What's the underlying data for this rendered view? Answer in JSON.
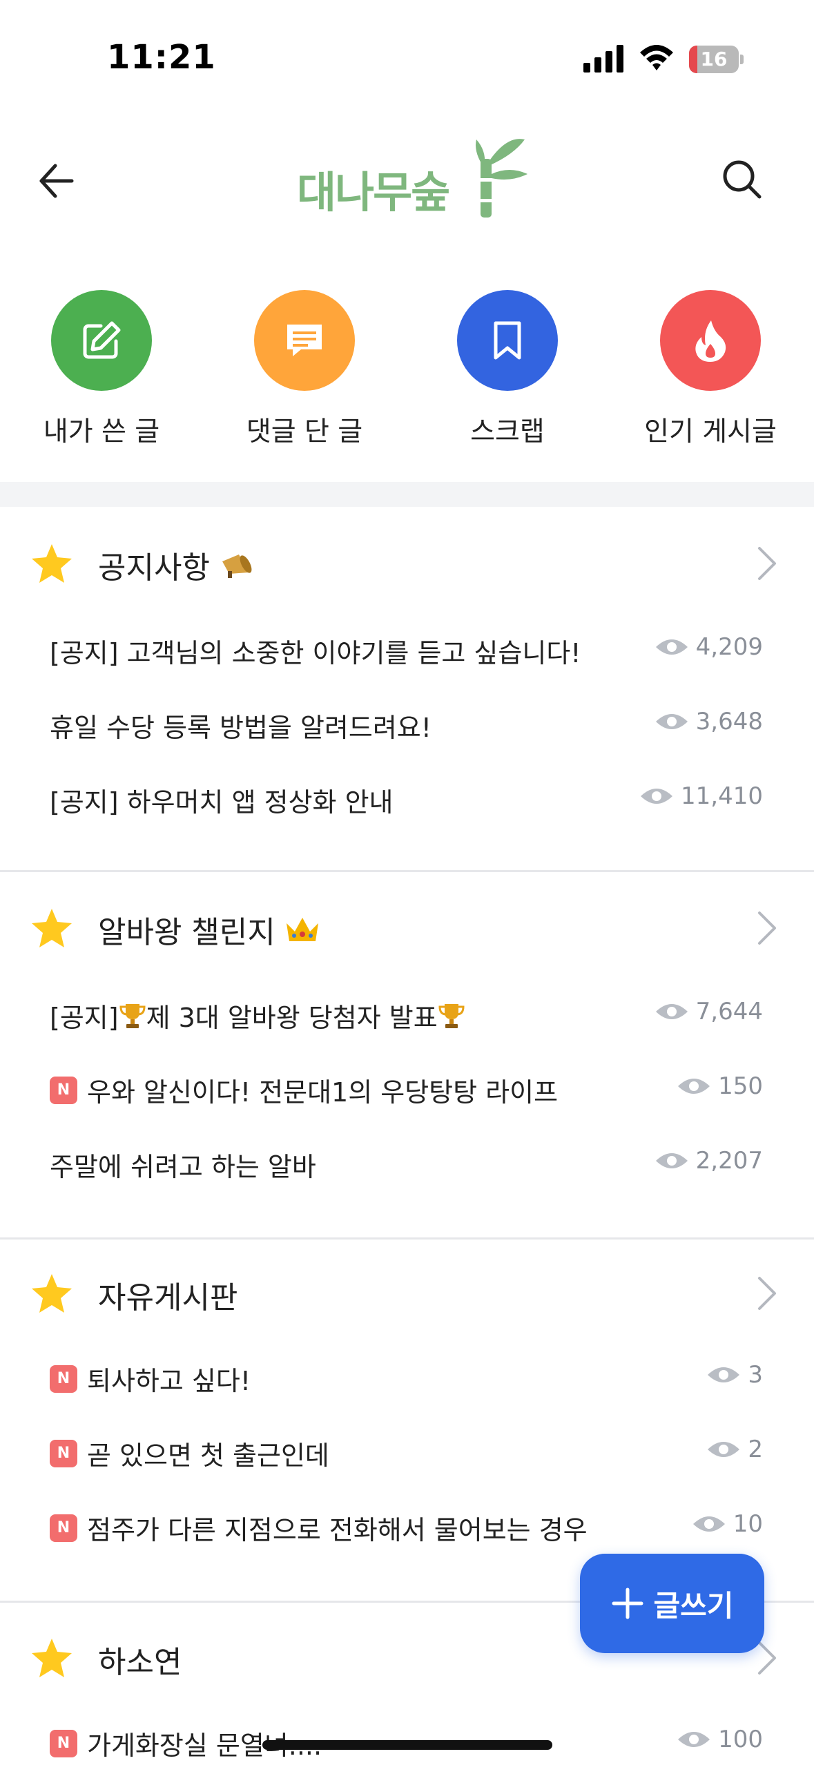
{
  "status": {
    "time": "11:21",
    "battery": "16",
    "battery_level": 0.16
  },
  "header": {
    "logo_text": "대나무숲",
    "back_icon": "back-arrow-icon",
    "search_icon": "search-icon"
  },
  "quick_actions": [
    {
      "label": "내가 쓴 글",
      "color": "#4caf50",
      "icon": "edit-icon"
    },
    {
      "label": "댓글 단 글",
      "color": "#ffa53a",
      "icon": "comment-icon"
    },
    {
      "label": "스크랩",
      "color": "#3364e0",
      "icon": "bookmark-icon"
    },
    {
      "label": "인기 게시글",
      "color": "#f35656",
      "icon": "fire-icon"
    }
  ],
  "sections": [
    {
      "title": "공지사항",
      "emoji": "megaphone",
      "posts": [
        {
          "title": "[공지] 고객님의 소중한 이야기를 듣고 싶습니다!",
          "views": "4,209",
          "new": false
        },
        {
          "title": "휴일 수당 등록 방법을 알려드려요!",
          "views": "3,648",
          "new": false
        },
        {
          "title": "[공지] 하우머치 앱 정상화 안내",
          "views": "11,410",
          "new": false
        }
      ]
    },
    {
      "title": "알바왕 챌린지",
      "emoji": "crown",
      "posts": [
        {
          "title_prefix": "[공지]",
          "title_middle": " 제 3대 알바왕 당첨자 발표",
          "views": "7,644",
          "new": false,
          "trophies": true
        },
        {
          "title": "우와 알신이다! 전문대1의 우당탕탕 라이프",
          "views": "150",
          "new": true
        },
        {
          "title": "주말에 쉬려고 하는 알바",
          "views": "2,207",
          "new": false
        }
      ]
    },
    {
      "title": "자유게시판",
      "posts": [
        {
          "title": "퇴사하고 싶다!",
          "views": "3",
          "new": true
        },
        {
          "title": "곧 있으면 첫 출근인데",
          "views": "2",
          "new": true
        },
        {
          "title": "점주가 다른 지점으로 전화해서 물어보는 경우",
          "views": "10",
          "new": true
        }
      ]
    },
    {
      "title": "하소연",
      "posts": [
        {
          "title": "가게화장실 문열녀....",
          "views": "100",
          "new": true
        }
      ]
    }
  ],
  "badge_new": "N",
  "fab": {
    "label": "글쓰기"
  }
}
